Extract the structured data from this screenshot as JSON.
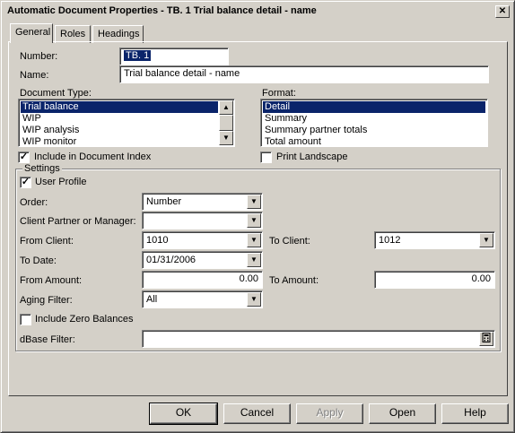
{
  "window": {
    "title": "Automatic Document Properties - TB. 1 Trial balance detail - name",
    "close_glyph": "✕"
  },
  "tabs": [
    {
      "label": "General"
    },
    {
      "label": "Roles"
    },
    {
      "label": "Headings"
    }
  ],
  "general": {
    "number_label": "Number:",
    "number_value": "TB. 1",
    "name_label": "Name:",
    "name_value": "Trial balance detail - name",
    "doc_type_label": "Document Type:",
    "doc_types": [
      "Trial balance",
      "WIP",
      "WIP analysis",
      "WIP monitor"
    ],
    "doc_type_selected": "Trial balance",
    "format_label": "Format:",
    "formats": [
      "Detail",
      "Summary",
      "Summary partner totals",
      "Total amount"
    ],
    "format_selected": "Detail",
    "include_index_label": "Include in Document Index",
    "include_index_checked": true,
    "print_landscape_label": "Print Landscape",
    "print_landscape_checked": false
  },
  "settings": {
    "title": "Settings",
    "user_profile_label": "User Profile",
    "user_profile_checked": true,
    "order_label": "Order:",
    "order_value": "Number",
    "client_partner_label": "Client Partner or Manager:",
    "client_partner_value": "",
    "from_client_label": "From Client:",
    "from_client_value": "1010",
    "to_client_label": "To Client:",
    "to_client_value": "1012",
    "to_date_label": "To Date:",
    "to_date_value": "01/31/2006",
    "from_amount_label": "From Amount:",
    "from_amount_value": "0.00",
    "to_amount_label": "To Amount:",
    "to_amount_value": "0.00",
    "aging_filter_label": "Aging Filter:",
    "aging_filter_value": "All",
    "include_zero_label": "Include Zero Balances",
    "include_zero_checked": false,
    "dbase_filter_label": "dBase Filter:",
    "dbase_filter_value": ""
  },
  "buttons": {
    "ok": "OK",
    "cancel": "Cancel",
    "apply": "Apply",
    "open": "Open",
    "help": "Help"
  },
  "glyphs": {
    "check": "✓",
    "dropdown": "▼",
    "scroll_up": "▲",
    "scroll_down": "▼"
  }
}
